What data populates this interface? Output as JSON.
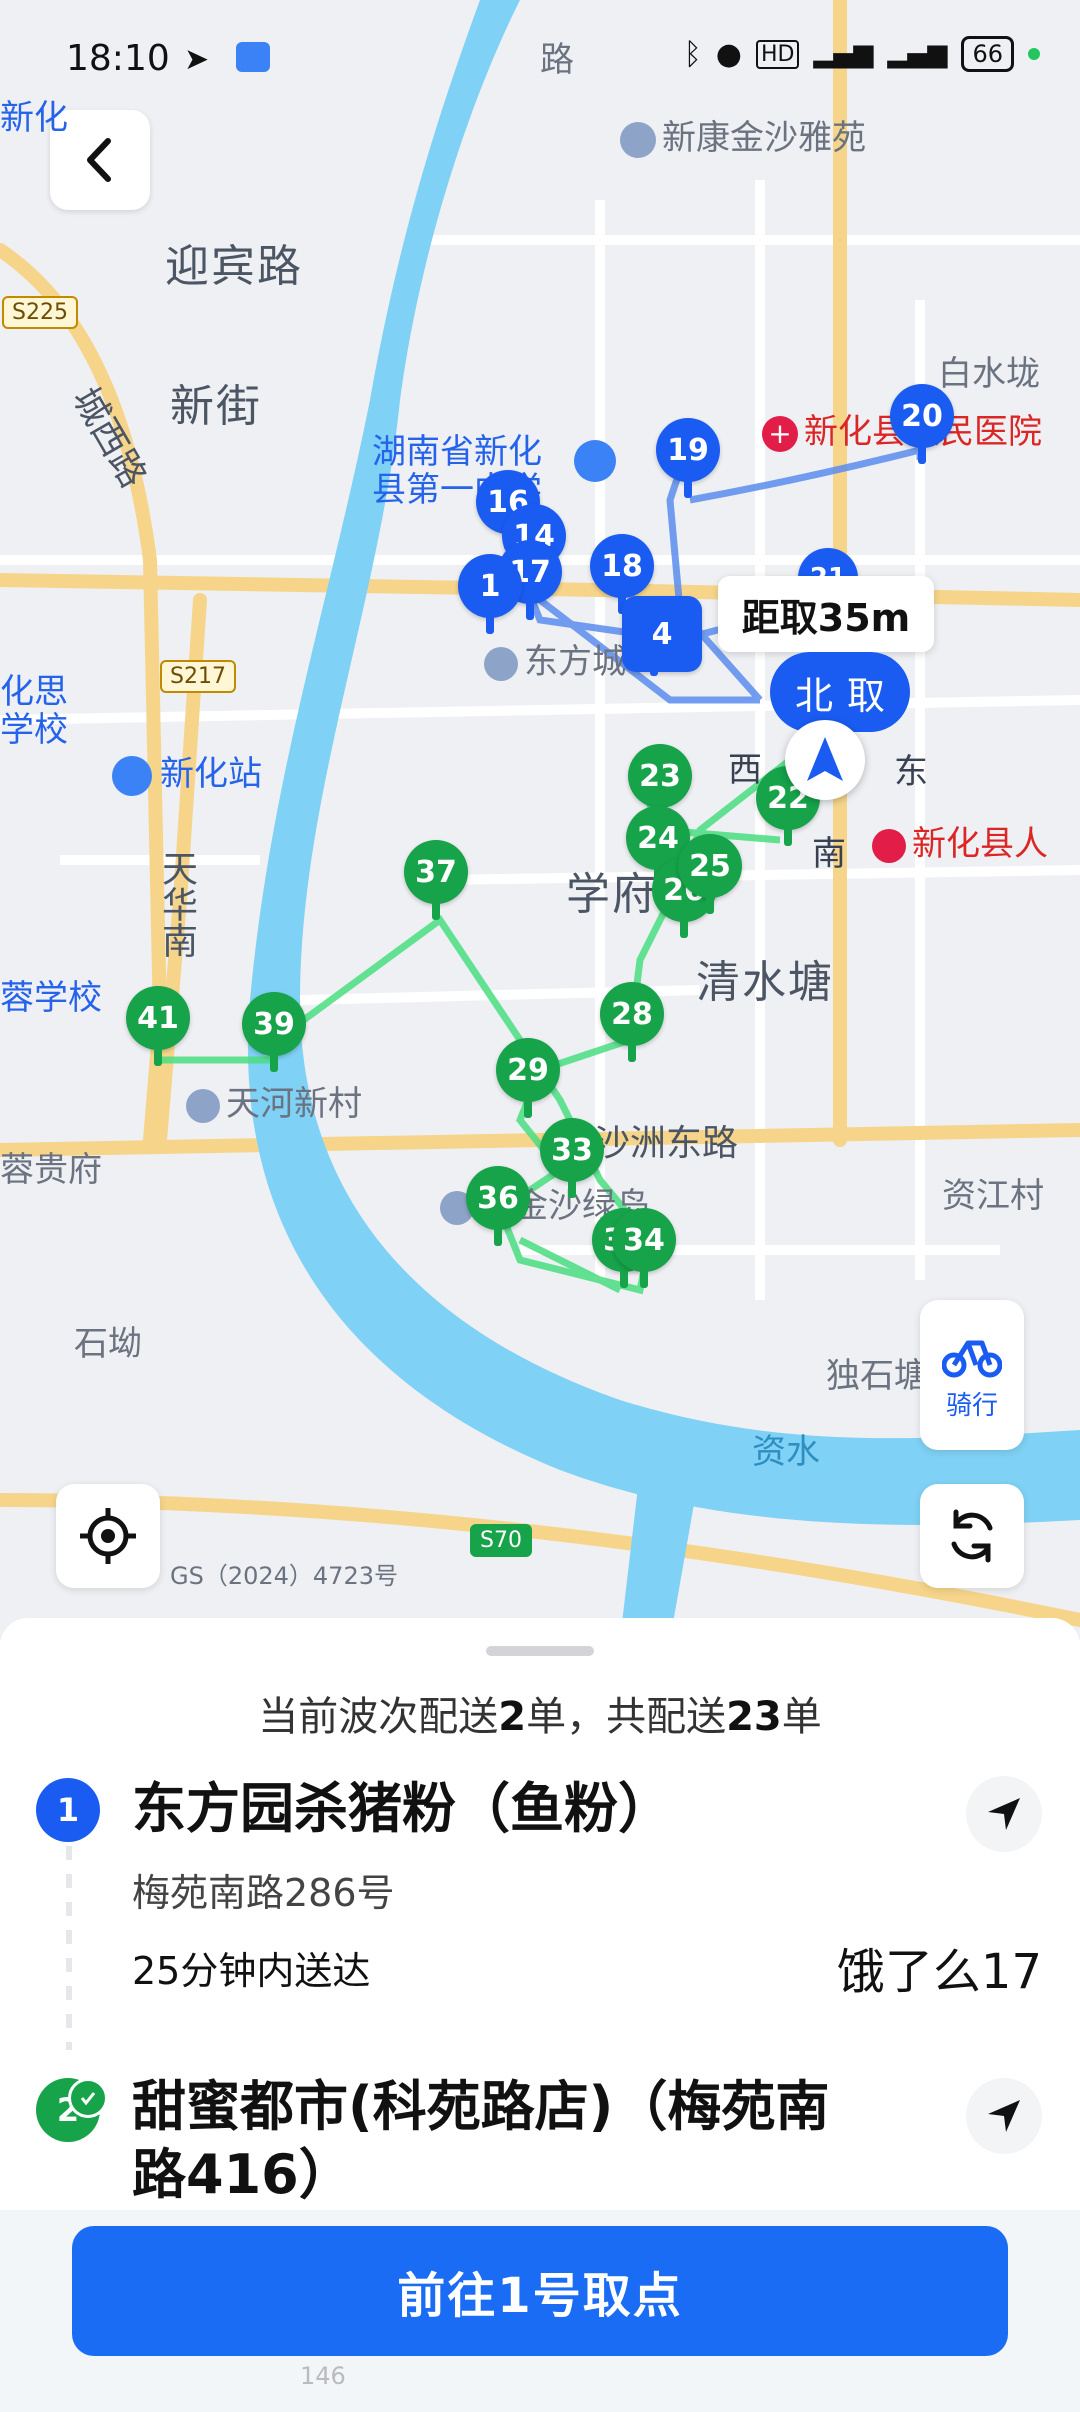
{
  "status_bar": {
    "time": "18:10",
    "hd_label": "HD",
    "battery": "66",
    "colors": {
      "online": "#22c55e"
    }
  },
  "map": {
    "labels": {
      "xinkang_jinsha": "新康金沙雅苑",
      "yingbin_road": "迎宾路",
      "xinjie": "新街",
      "chengxi_road": "城西路",
      "baishui_long": "白水垅",
      "xinhua_hospital": "新化县人民医院",
      "hunan_xinhua_1": "湖南省新化",
      "hunan_xinhua_2": "县第一中学",
      "dongfang_cheng": "东方城",
      "xinhua_station": "新化站",
      "xuefu_road": "学府路",
      "qingshui_tang": "清水塘",
      "tianhua_south": "天华南",
      "rong_school": "蓉学校",
      "tianhe_village": "天河新村",
      "shazhou_east": "沙洲东路",
      "jinsha_lvdao": "康金沙绿岛",
      "rong_gui": "蓉贵府",
      "zijiang_village": "资江村",
      "shi_ao": "石坳",
      "dushi_tang": "独石塘",
      "zi_shui": "资水",
      "xinhua_county_person": "新化县人",
      "xi": "西",
      "dong": "东",
      "nan": "南",
      "huasi_1": "化思",
      "huasi_2": "学校",
      "top_left": "新化",
      "lu_top": "路",
      "road_s225": "S225",
      "road_s217": "S217",
      "road_s70": "S70"
    },
    "pins": {
      "blue": [
        "16",
        "14",
        "17",
        "1",
        "18",
        "19",
        "20",
        "4",
        "21"
      ],
      "green": [
        "23",
        "24",
        "22",
        "25",
        "26",
        "37",
        "41",
        "39",
        "28",
        "29",
        "33",
        "36",
        "32",
        "34"
      ]
    },
    "distance_tip": "距取35m",
    "pickup_pill": {
      "left": "北",
      "right": "取"
    },
    "ride_mode_label": "骑行",
    "gs_number": "GS（2024）4723号",
    "colors": {
      "water": "#7fd1f5",
      "route_blue": "#5b8def",
      "route_green": "#4ade80",
      "main_road": "#f6d58a"
    }
  },
  "sheet": {
    "summary_prefix": "当前波次配送",
    "current_count": "2",
    "summary_mid": "单，共配送",
    "total_count": "23",
    "summary_suffix": "单",
    "orders": [
      {
        "index": "1",
        "shop_name": "东方园杀猪粉（鱼粉）",
        "address": "梅苑南路286号",
        "deliver_time": "25分钟内送达",
        "platform": "饿了么17"
      },
      {
        "index": "2",
        "shop_name_line1": "甜蜜都市(科苑路店)（梅苑南",
        "shop_name_line2": "路416）"
      }
    ],
    "go_button": "前往1号取点",
    "faint_text": "146"
  }
}
